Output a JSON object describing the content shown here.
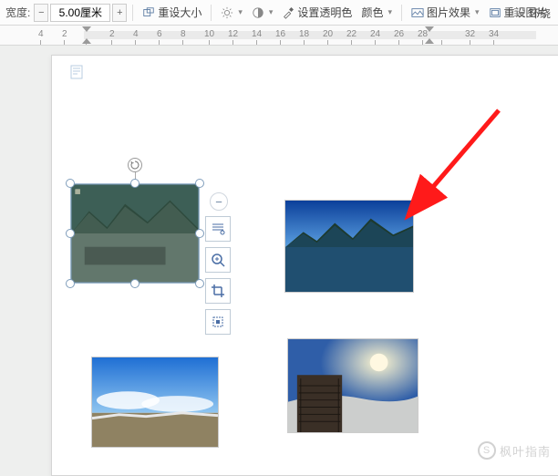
{
  "toolbar": {
    "width_label": "宽度:",
    "width_value": "5.00厘米",
    "reset_size": "重设大小",
    "set_transparent": "设置透明色",
    "color": "颜色",
    "pic_effect": "图片效果",
    "reset_pic": "重设图片",
    "wrap": "环绕"
  },
  "ruler": {
    "marks": [
      "4",
      "2",
      "",
      "2",
      "4",
      "6",
      "8",
      "10",
      "12",
      "14",
      "16",
      "18",
      "20",
      "22",
      "24",
      "26",
      "28",
      "",
      "32",
      "34"
    ]
  },
  "float_tools": {
    "zoom_out": "−",
    "zoom_in": "zoom",
    "layout_opts": "layout",
    "crop": "crop",
    "more": "more"
  },
  "watermark": {
    "text": "枫叶指南"
  },
  "colors": {
    "arrow": "#ff1a1a",
    "accent": "#4a6ea5"
  }
}
